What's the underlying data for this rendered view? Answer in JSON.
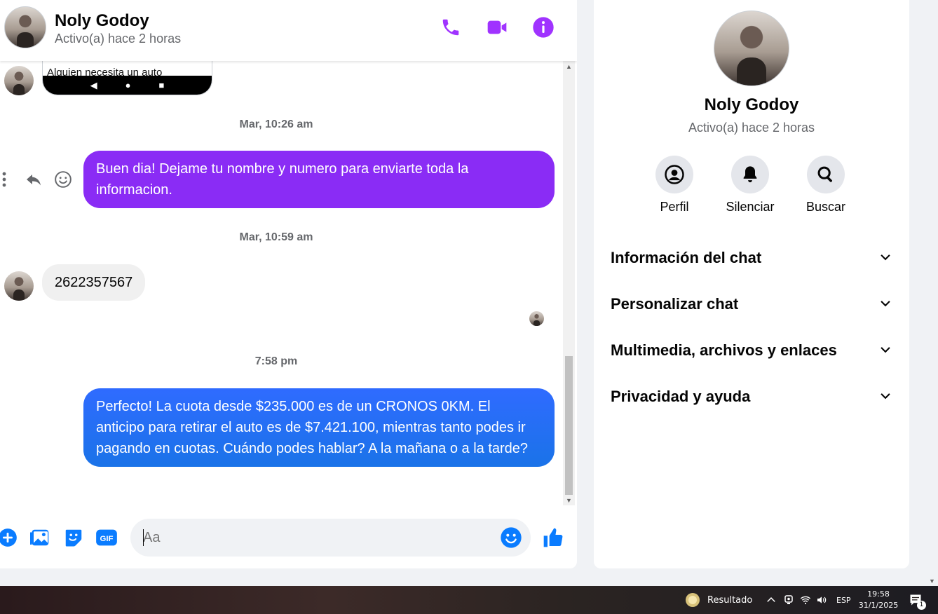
{
  "contact": {
    "name": "Noly Godoy",
    "status": "Activo(a) hace 2 horas"
  },
  "header_actions": [
    {
      "icon": "phone-icon",
      "label": "Llamada de voz"
    },
    {
      "icon": "video-icon",
      "label": "Videollamada"
    },
    {
      "icon": "info-icon",
      "label": "Información de la conversación"
    }
  ],
  "conversation": {
    "preview_text": "Alguien necesita un auto",
    "timestamps": [
      "Mar, 10:26 am",
      "Mar, 10:59 am",
      "7:58 pm"
    ],
    "messages": [
      {
        "direction": "out",
        "text": "Buen dia! Dejame tu nombre y numero para enviarte toda la informacion."
      },
      {
        "direction": "in",
        "text": "2622357567"
      },
      {
        "direction": "out",
        "text": "Perfecto! La cuota desde $235.000 es de un CRONOS 0KM. El anticipo para retirar el auto es de $7.421.100, mientras tanto podes ir pagando en cuotas. Cuándo podes hablar? A la mañana o a la tarde?"
      }
    ]
  },
  "composer": {
    "placeholder": "Aa",
    "icons": [
      "plus-icon",
      "image-icon",
      "sticker-icon",
      "gif-icon",
      "emoji-icon",
      "like-icon"
    ]
  },
  "info_panel": {
    "name": "Noly Godoy",
    "status": "Activo(a) hace 2 horas",
    "actions": [
      {
        "label": "Perfil",
        "icon": "profile-icon"
      },
      {
        "label": "Silenciar",
        "icon": "bell-icon"
      },
      {
        "label": "Buscar",
        "icon": "search-icon"
      }
    ],
    "sections": [
      "Información del chat",
      "Personalizar chat",
      "Multimedia, archivos y enlaces",
      "Privacidad y ayuda"
    ]
  },
  "taskbar": {
    "weather_label": "Resultado",
    "language": "ESP",
    "time": "19:58",
    "date": "31/1/2025",
    "notification_count": "1"
  },
  "colors": {
    "accent_purple": "#a033ff",
    "bubble_purple": "#8a2cf5",
    "bubble_blue": "#1a73e8",
    "composer_blue": "#0a7cff"
  }
}
